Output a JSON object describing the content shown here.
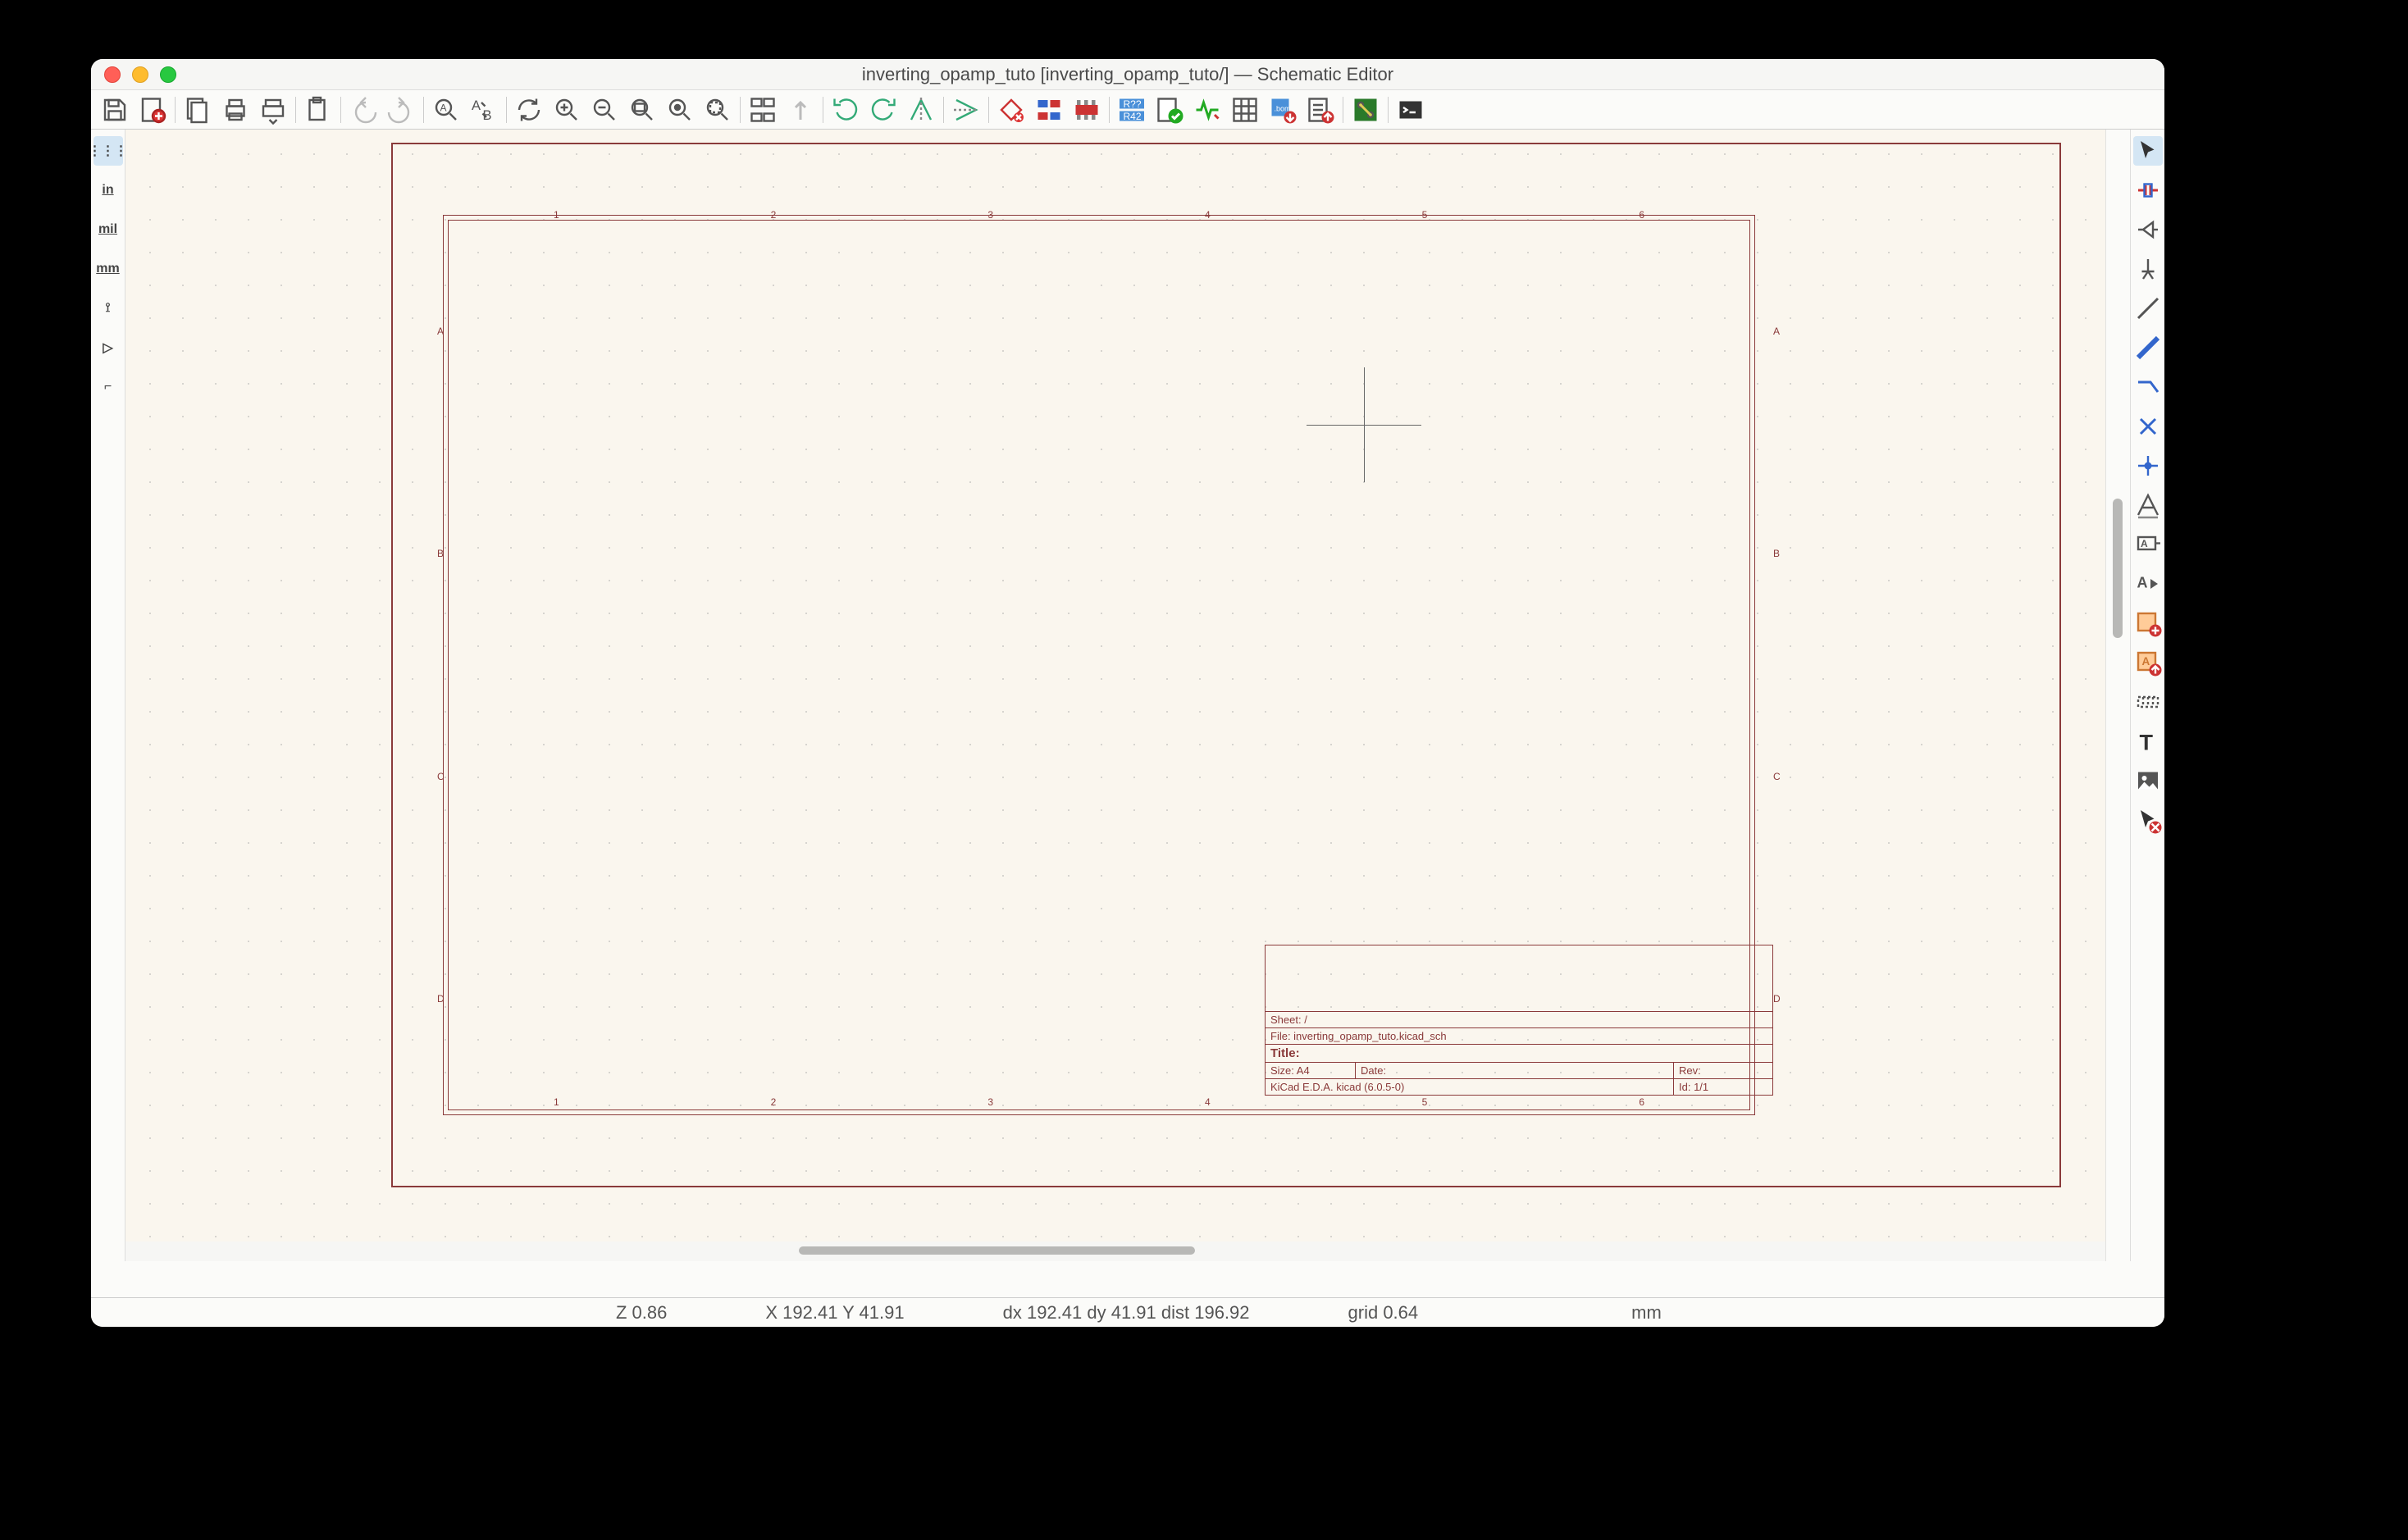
{
  "window": {
    "title": "inverting_opamp_tuto [inverting_opamp_tuto/] — Schematic Editor"
  },
  "toolbar_main": [
    {
      "name": "save-icon"
    },
    {
      "name": "page-settings-icon"
    },
    {
      "sep": true
    },
    {
      "name": "new-sheet-icon"
    },
    {
      "name": "print-icon"
    },
    {
      "name": "plot-icon"
    },
    {
      "sep": true
    },
    {
      "name": "paste-icon"
    },
    {
      "sep": true
    },
    {
      "name": "undo-icon"
    },
    {
      "name": "redo-icon"
    },
    {
      "sep": true
    },
    {
      "name": "find-icon"
    },
    {
      "name": "find-replace-icon"
    },
    {
      "sep": true
    },
    {
      "name": "refresh-icon"
    },
    {
      "name": "zoom-in-icon"
    },
    {
      "name": "zoom-out-icon"
    },
    {
      "name": "zoom-fit-icon"
    },
    {
      "name": "zoom-object-icon"
    },
    {
      "name": "zoom-selection-icon"
    },
    {
      "sep": true
    },
    {
      "name": "hierarchy-icon"
    },
    {
      "name": "up-hierarchy-icon"
    },
    {
      "sep": true
    },
    {
      "name": "rotate-ccw-icon"
    },
    {
      "name": "rotate-cw-icon"
    },
    {
      "name": "mirror-h-icon"
    },
    {
      "sep": true
    },
    {
      "name": "mirror-v-icon"
    },
    {
      "sep": true
    },
    {
      "name": "symbol-editor-icon"
    },
    {
      "name": "browse-symbols-icon"
    },
    {
      "name": "footprint-assign-icon"
    },
    {
      "sep": true
    },
    {
      "name": "annotate-icon"
    },
    {
      "name": "erc-icon"
    },
    {
      "name": "simulator-icon"
    },
    {
      "name": "bom-icon"
    },
    {
      "name": "export-bom-icon"
    },
    {
      "name": "netlist-icon"
    },
    {
      "sep": true
    },
    {
      "name": "pcb-icon"
    },
    {
      "sep": true
    },
    {
      "name": "scripting-icon"
    }
  ],
  "left_toolbar": [
    {
      "name": "grid-icon",
      "label": "⋮⋮⋮",
      "sel": true
    },
    {
      "name": "unit-in",
      "label": "in"
    },
    {
      "name": "unit-mil",
      "label": "mil"
    },
    {
      "name": "unit-mm",
      "label": "mm"
    },
    {
      "name": "cursor-full-icon",
      "label": "⟟"
    },
    {
      "name": "hidden-pins-icon",
      "label": "▷"
    },
    {
      "name": "origin-icon",
      "label": "⌐"
    }
  ],
  "right_toolbar": [
    {
      "name": "select-icon",
      "sel": true
    },
    {
      "name": "highlight-net-icon"
    },
    {
      "name": "add-symbol-icon"
    },
    {
      "name": "add-power-icon"
    },
    {
      "name": "add-wire-icon"
    },
    {
      "name": "add-bus-icon"
    },
    {
      "name": "add-wire-entry-icon"
    },
    {
      "name": "add-noconnect-icon"
    },
    {
      "name": "add-junction-icon"
    },
    {
      "name": "add-label-icon"
    },
    {
      "name": "add-netclass-icon"
    },
    {
      "name": "add-global-label-icon"
    },
    {
      "name": "add-hier-sheet-icon"
    },
    {
      "name": "import-sheet-pin-icon"
    },
    {
      "name": "add-hier-label-icon"
    },
    {
      "name": "add-text-icon"
    },
    {
      "name": "add-image-icon"
    },
    {
      "name": "delete-icon"
    }
  ],
  "sheet_frame": {
    "cols": [
      "1",
      "2",
      "3",
      "4",
      "5",
      "6"
    ],
    "rows": [
      "A",
      "B",
      "C",
      "D"
    ]
  },
  "titleblock": {
    "sheet": "Sheet: /",
    "file": "File: inverting_opamp_tuto.kicad_sch",
    "title_label": "Title:",
    "size": "Size: A4",
    "date_label": "Date:",
    "rev_label": "Rev:",
    "kicad": "KiCad E.D.A.  kicad (6.0.5-0)",
    "id": "Id: 1/1"
  },
  "statusbar": {
    "zoom": "Z 0.86",
    "xy": "X 192.41  Y 41.91",
    "dxy": "dx 192.41  dy 41.91  dist 196.92",
    "grid": "grid 0.64",
    "unit": "mm"
  }
}
